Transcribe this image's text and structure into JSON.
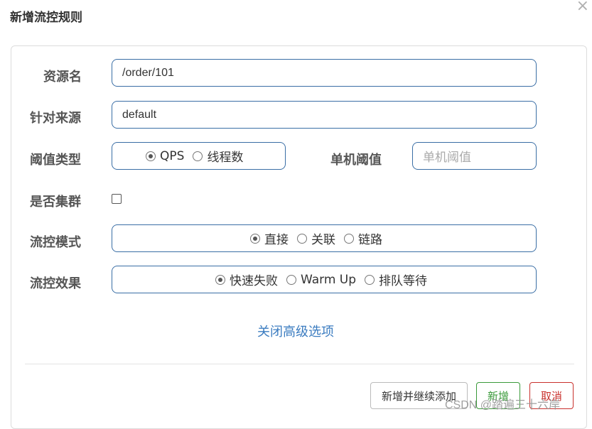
{
  "dialog": {
    "title": "新增流控规则",
    "close_glyph": "×"
  },
  "form": {
    "resource": {
      "label": "资源名",
      "value": "/order/101"
    },
    "limit_app": {
      "label": "针对来源",
      "value": "default"
    },
    "grade": {
      "label": "阈值类型",
      "options": [
        "QPS",
        "线程数"
      ],
      "selected": "QPS"
    },
    "count": {
      "label": "单机阈值",
      "placeholder": "单机阈值",
      "value": ""
    },
    "cluster": {
      "label": "是否集群",
      "checked": false
    },
    "strategy": {
      "label": "流控模式",
      "options": [
        "直接",
        "关联",
        "链路"
      ],
      "selected": "直接"
    },
    "control_behavior": {
      "label": "流控效果",
      "options": [
        "快速失败",
        "Warm Up",
        "排队等待"
      ],
      "selected": "快速失败"
    },
    "advanced_toggle": "关闭高级选项"
  },
  "footer": {
    "add_and_continue": "新增并继续添加",
    "add": "新增",
    "cancel": "取消"
  },
  "watermark": "CSDN @踏遍三十六岸",
  "colors": {
    "border_accent": "#3a6ea5",
    "link": "#3b7cc0",
    "add_button": "#3a9a3a",
    "cancel_button": "#c9302c"
  }
}
